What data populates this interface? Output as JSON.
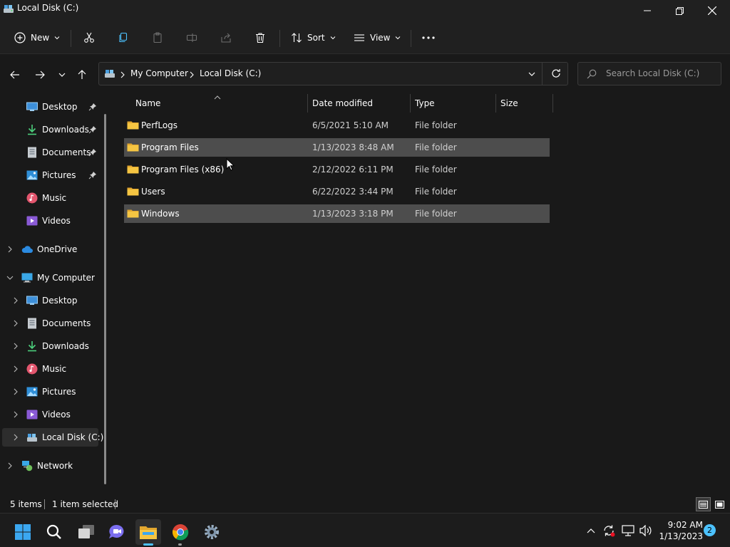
{
  "window": {
    "title": "Local Disk (C:)"
  },
  "toolbar": {
    "new_label": "New",
    "sort_label": "Sort",
    "view_label": "View"
  },
  "address": {
    "crumbs": [
      "My Computer",
      "Local Disk (C:)"
    ],
    "search_placeholder": "Search Local Disk (C:)"
  },
  "nav": {
    "quick_access": [
      {
        "label": "Desktop",
        "icon": "desktop-icon",
        "pinned": true
      },
      {
        "label": "Downloads",
        "icon": "download-icon",
        "pinned": true
      },
      {
        "label": "Documents",
        "icon": "document-icon",
        "pinned": true
      },
      {
        "label": "Pictures",
        "icon": "pictures-icon",
        "pinned": true
      },
      {
        "label": "Music",
        "icon": "music-icon",
        "pinned": false
      },
      {
        "label": "Videos",
        "icon": "videos-icon",
        "pinned": false
      }
    ],
    "onedrive": "OneDrive",
    "my_computer": "My Computer",
    "computer_children": [
      {
        "label": "Desktop",
        "icon": "desktop-icon"
      },
      {
        "label": "Documents",
        "icon": "document-icon"
      },
      {
        "label": "Downloads",
        "icon": "download-icon"
      },
      {
        "label": "Music",
        "icon": "music-icon"
      },
      {
        "label": "Pictures",
        "icon": "pictures-icon"
      },
      {
        "label": "Videos",
        "icon": "videos-icon"
      },
      {
        "label": "Local Disk (C:)",
        "icon": "drive-icon",
        "selected": true
      }
    ],
    "network": "Network"
  },
  "columns": {
    "name": "Name",
    "date": "Date modified",
    "type": "Type",
    "size": "Size"
  },
  "files": [
    {
      "name": "PerfLogs",
      "date": "6/5/2021 5:10 AM",
      "type": "File folder",
      "selected": false
    },
    {
      "name": "Program Files",
      "date": "1/13/2023 8:48 AM",
      "type": "File folder",
      "selected": true
    },
    {
      "name": "Program Files (x86)",
      "date": "2/12/2022 6:11 PM",
      "type": "File folder",
      "selected": false
    },
    {
      "name": "Users",
      "date": "6/22/2022 3:44 PM",
      "type": "File folder",
      "selected": false
    },
    {
      "name": "Windows",
      "date": "1/13/2023 3:18 PM",
      "type": "File folder",
      "selected": true
    }
  ],
  "status": {
    "item_count": "5 items",
    "selection": "1 item selected"
  },
  "taskbar": {
    "time": "9:02 AM",
    "date": "1/13/2023",
    "notification_count": "2"
  },
  "colors": {
    "accent": "#4cc2ff",
    "folder": "#f5c542",
    "selection": "#4d4d4d"
  }
}
